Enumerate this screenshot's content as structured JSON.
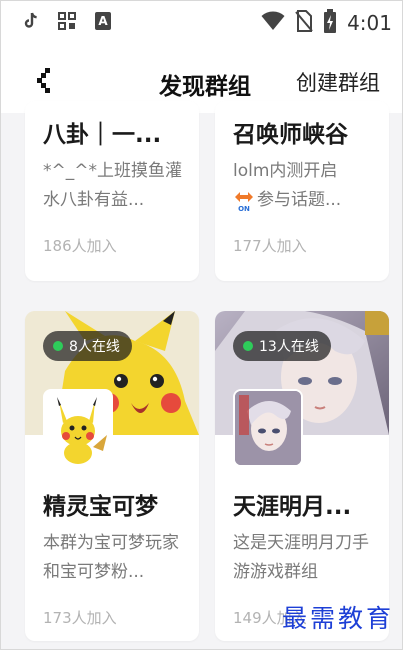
{
  "status_bar": {
    "time": "4:01",
    "icons": [
      "tiktok-icon",
      "qr-icon",
      "a-badge-icon",
      "wifi-icon",
      "no-sim-icon",
      "battery-charging-icon"
    ]
  },
  "header": {
    "title": "发现群组",
    "create_label": "创建群组",
    "back_icon": "back-arrow-icon"
  },
  "groups": [
    {
      "name": "八卦｜一...",
      "description": "*^_^*上班摸鱼灌水八卦有益...",
      "members": "186人加入"
    },
    {
      "name": "召唤师峡谷",
      "description_line1": "lolm内测开启",
      "description_line2": "参与话题...",
      "topic_badge_text": "ON",
      "members": "177人加入"
    },
    {
      "name": "精灵宝可梦",
      "online": "8人在线",
      "description": "本群为宝可梦玩家和宝可梦粉...",
      "members": "173人加入"
    },
    {
      "name": "天涯明月...",
      "online": "13人在线",
      "description": "这是天涯明月刀手游游戏群组",
      "members": "149人加入"
    }
  ],
  "watermark": "最需教育",
  "colors": {
    "online_dot": "#2ecc5a",
    "background": "#f4f4f6",
    "watermark": "#1d3fd6"
  }
}
